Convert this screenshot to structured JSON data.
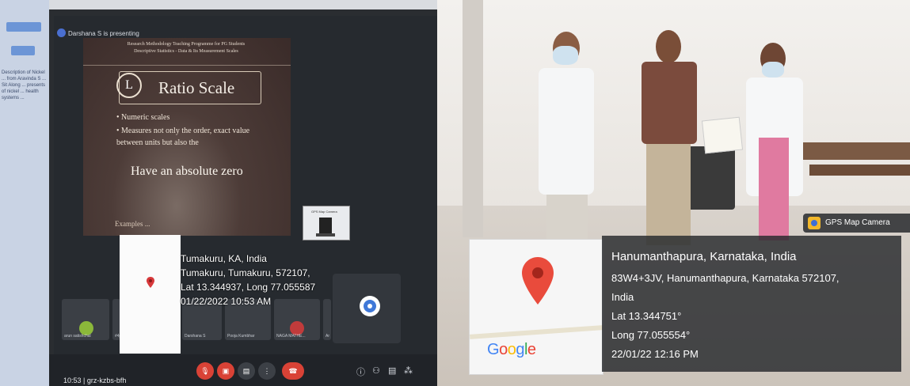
{
  "left_panel": {
    "presenting_text": "Darshana S is presenting",
    "sidebar_snippet": "Description of Nickel ... from Aravinda S ... Sit Along ... presents of nickel ... health systems ...",
    "slide": {
      "header_line1": "Research Methodology Teaching Programme for PG Students",
      "header_line2": "Descriptive Statistics - Data & Its Measurement Scales",
      "badge": "L",
      "title": "Ratio Scale",
      "bullets": [
        "• Numeric scales",
        "• Measures not only the order, exact value",
        "between units but also the"
      ],
      "emphasis": "Have an absolute zero",
      "footer": "Examples ..."
    },
    "mini_cam_label": "GPS Map Camera",
    "geo": {
      "lines": [
        "Tumakuru, KA, India",
        "Tumakuru, Tumakuru, 572107,",
        "Lat 13.344937, Long 77.055587",
        "01/22/2022 10:53 AM"
      ]
    },
    "tiles": [
      "arun satishchal",
      "#4pm",
      "Darshana S",
      "Pooja Kumbhar",
      "NAGA MATHE...",
      "Ar"
    ],
    "time_and_code": "10:53 | grz-kzbs-bfh"
  },
  "right_panel": {
    "gps_badge": "GPS Map Camera",
    "google_logo": [
      "G",
      "o",
      "o",
      "g",
      "l",
      "e"
    ],
    "info": {
      "title": "Hanumanthapura, Karnataka, India",
      "address_1": "83W4+3JV, Hanumanthapura, Karnataka 572107,",
      "address_2": "India",
      "lat": "Lat 13.344751°",
      "long": "Long 77.055554°",
      "datetime": "22/01/22 12:16 PM"
    }
  }
}
